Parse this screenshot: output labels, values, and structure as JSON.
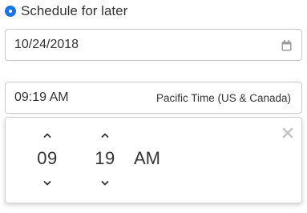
{
  "schedule": {
    "radio_label": "Schedule for later",
    "selected": true
  },
  "date_field": {
    "value": "10/24/2018",
    "icon": "calendar-icon"
  },
  "time_field": {
    "value": "09:19 AM",
    "timezone": "Pacific Time (US & Canada)"
  },
  "time_picker": {
    "hour": "09",
    "minute": "19",
    "period": "AM",
    "close_icon": "close-icon",
    "up_icon": "chevron-up-icon",
    "down_icon": "chevron-down-icon"
  },
  "colors": {
    "accent": "#1a73e8",
    "text": "#333333",
    "border": "#c8c8c8",
    "icon_muted": "#9e9e9e"
  }
}
